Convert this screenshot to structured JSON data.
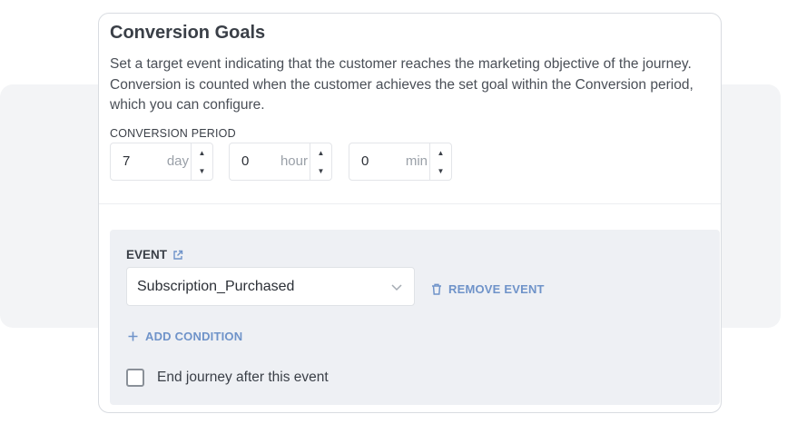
{
  "card": {
    "title": "Conversion Goals",
    "description": "Set a target event indicating that the customer reaches the marketing objective of the journey. Conversion is counted when the customer achieves the set goal within the Conversion period, which you can configure."
  },
  "period": {
    "label": "CONVERSION PERIOD",
    "fields": [
      {
        "value": "7",
        "unit": "day"
      },
      {
        "value": "0",
        "unit": "hour"
      },
      {
        "value": "0",
        "unit": "min"
      }
    ]
  },
  "event": {
    "label": "EVENT",
    "selected": "Subscription_Purchased",
    "remove_label": "REMOVE EVENT",
    "add_condition_label": "ADD CONDITION",
    "end_journey_label": "End journey after this event"
  },
  "colors": {
    "accent": "#6f93c9",
    "event_box_bg": "#eef0f4",
    "page_band": "#f3f4f6"
  },
  "icons": [
    "external-link-icon",
    "chevron-down-icon",
    "trash-icon",
    "plus-icon",
    "caret-up-icon",
    "caret-down-icon"
  ]
}
